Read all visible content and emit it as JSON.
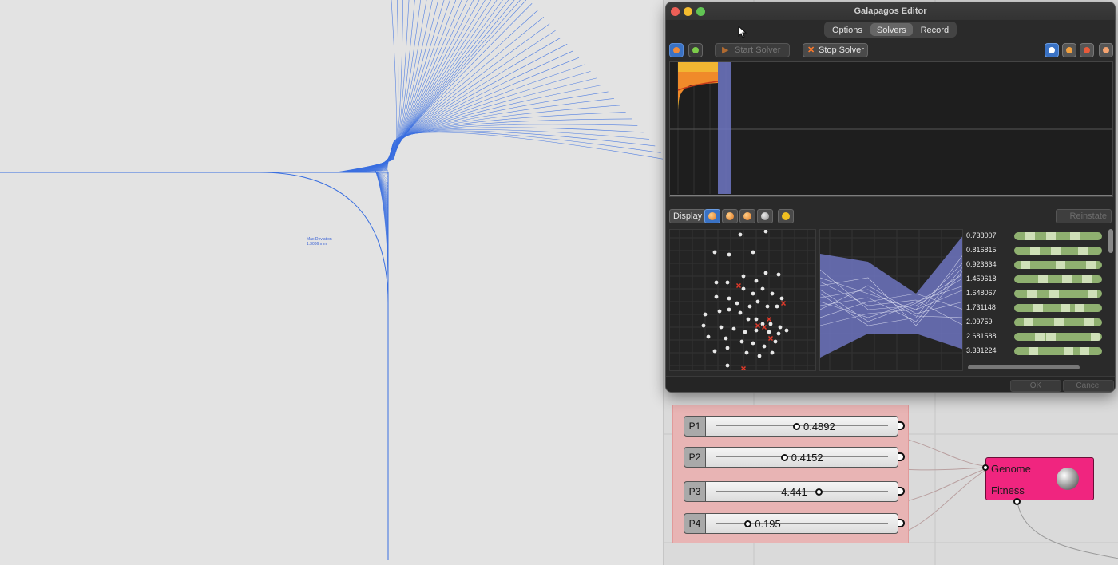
{
  "galapagos": {
    "title": "Galapagos Editor",
    "tabs": [
      "Options",
      "Solvers",
      "Record"
    ],
    "active_tab": "Solvers",
    "start_solver_label": "Start Solver",
    "stop_solver_label": "Stop Solver",
    "display_label": "Display",
    "reinstate_label": "Reinstate",
    "ok_label": "OK",
    "cancel_label": "Cancel",
    "convergence_ticks": [
      "0",
      "1",
      "2",
      "3"
    ],
    "genome_values": [
      "0.738007",
      "0.816815",
      "0.923634",
      "1.459618",
      "1.648067",
      "1.731148",
      "2.09759",
      "2.681588",
      "3.331224"
    ]
  },
  "viewport": {
    "label_line1": "Max Deviation",
    "label_line2": "1.3086 mm",
    "line_color": "#3a6fe0"
  },
  "sliders": [
    {
      "name": "P1",
      "value": "0.4892",
      "fraction": 0.47
    },
    {
      "name": "P2",
      "value": "0.4152",
      "fraction": 0.4
    },
    {
      "name": "P3",
      "value": "4.441",
      "fraction": 0.6
    },
    {
      "name": "P4",
      "value": "0.195",
      "fraction": 0.19
    }
  ],
  "component": {
    "input_label": "Genome",
    "output_label": "Fitness",
    "color": "#f0257f",
    "icon": "galapagos-icon"
  }
}
